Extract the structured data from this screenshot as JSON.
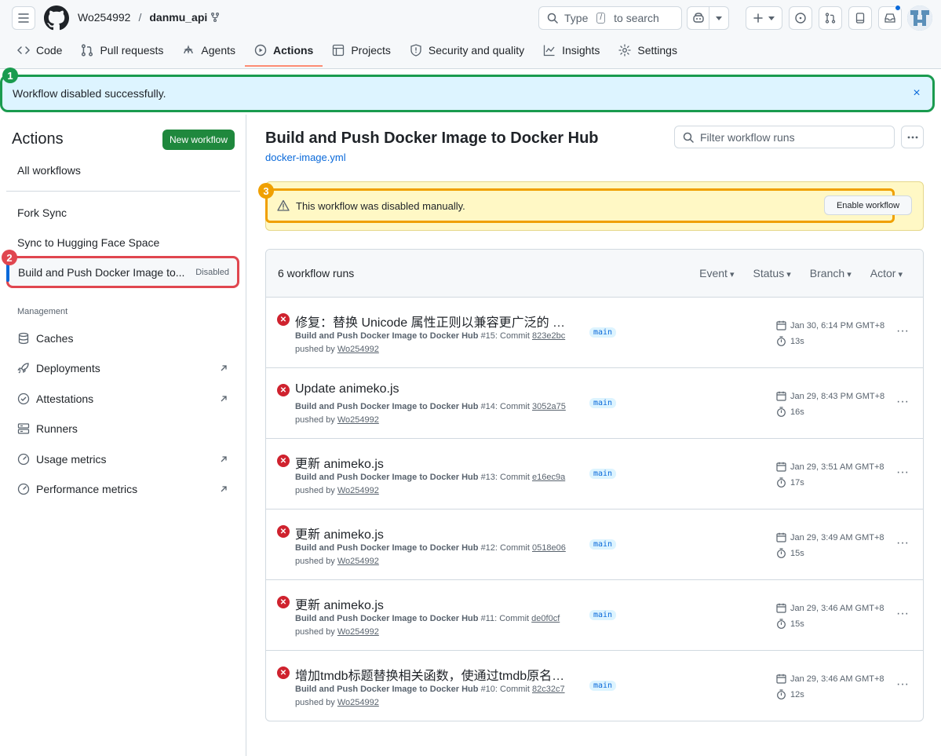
{
  "header": {
    "owner": "Wo254992",
    "separator": "/",
    "repo": "danmu_api",
    "search_prefix": "Type",
    "search_key": "/",
    "search_suffix": "to search"
  },
  "repo_nav": [
    {
      "label": "Code",
      "icon": "code-icon"
    },
    {
      "label": "Pull requests",
      "icon": "pull-request-icon"
    },
    {
      "label": "Agents",
      "icon": "agents-icon"
    },
    {
      "label": "Actions",
      "icon": "play-icon",
      "active": true
    },
    {
      "label": "Projects",
      "icon": "table-icon"
    },
    {
      "label": "Security and quality",
      "icon": "shield-icon"
    },
    {
      "label": "Insights",
      "icon": "graph-icon"
    },
    {
      "label": "Settings",
      "icon": "gear-icon"
    }
  ],
  "flash": {
    "message": "Workflow disabled successfully.",
    "close": "×",
    "marker": "1"
  },
  "sidebar": {
    "title": "Actions",
    "new_workflow": "New workflow",
    "all_workflows": "All workflows",
    "workflows": [
      "Fork Sync",
      "Sync to Hugging Face Space"
    ],
    "selected": {
      "label": "Build and Push Docker Image to...",
      "status": "Disabled",
      "marker": "2"
    },
    "management_title": "Management",
    "management": [
      {
        "label": "Caches",
        "icon": "database-icon",
        "external": false
      },
      {
        "label": "Deployments",
        "icon": "rocket-icon",
        "external": true
      },
      {
        "label": "Attestations",
        "icon": "verified-icon",
        "external": true
      },
      {
        "label": "Runners",
        "icon": "server-icon",
        "external": false
      },
      {
        "label": "Usage metrics",
        "icon": "meter-icon",
        "external": true
      },
      {
        "label": "Performance metrics",
        "icon": "meter-icon",
        "external": true
      }
    ]
  },
  "main": {
    "title": "Build and Push Docker Image to Docker Hub",
    "file": "docker-image.yml",
    "filter_placeholder": "Filter workflow runs",
    "warning": "This workflow was disabled manually.",
    "warning_marker": "3",
    "enable_button": "Enable workflow",
    "runs_count": "6 workflow runs",
    "filters": [
      "Event",
      "Status",
      "Branch",
      "Actor"
    ],
    "runs": [
      {
        "title": "修复：替换 Unicode 属性正则以兼容更广泛的 No...",
        "workflow": "Build and Push Docker Image to Docker Hub",
        "number": "#15: Commit",
        "commit": "823e2bc",
        "pushed_by": "pushed by",
        "user": "Wo254992",
        "branch": "main",
        "date": "Jan 30, 6:14 PM GMT+8",
        "duration": "13s"
      },
      {
        "title": "Update animeko.js",
        "workflow": "Build and Push Docker Image to Docker Hub",
        "number": "#14: Commit",
        "commit": "3052a75",
        "pushed_by": "pushed by",
        "user": "Wo254992",
        "branch": "main",
        "date": "Jan 29, 8:43 PM GMT+8",
        "duration": "16s"
      },
      {
        "title": "更新 animeko.js",
        "workflow": "Build and Push Docker Image to Docker Hub",
        "number": "#13: Commit",
        "commit": "e16ec9a",
        "pushed_by": "pushed by",
        "user": "Wo254992",
        "branch": "main",
        "date": "Jan 29, 3:51 AM GMT+8",
        "duration": "17s"
      },
      {
        "title": "更新 animeko.js",
        "workflow": "Build and Push Docker Image to Docker Hub",
        "number": "#12: Commit",
        "commit": "0518e06",
        "pushed_by": "pushed by",
        "user": "Wo254992",
        "branch": "main",
        "date": "Jan 29, 3:49 AM GMT+8",
        "duration": "15s"
      },
      {
        "title": "更新 animeko.js",
        "workflow": "Build and Push Docker Image to Docker Hub",
        "number": "#11: Commit",
        "commit": "de0f0cf",
        "pushed_by": "pushed by",
        "user": "Wo254992",
        "branch": "main",
        "date": "Jan 29, 3:46 AM GMT+8",
        "duration": "15s"
      },
      {
        "title": "增加tmdb标题替换相关函数，使通过tmdb原名搜...",
        "workflow": "Build and Push Docker Image to Docker Hub",
        "number": "#10: Commit",
        "commit": "82c32c7",
        "pushed_by": "pushed by",
        "user": "Wo254992",
        "branch": "main",
        "date": "Jan 29, 3:46 AM GMT+8",
        "duration": "12s"
      }
    ]
  },
  "colors": {
    "accent": "#0969da",
    "success": "#1f883d",
    "danger": "#cf222e",
    "marker_green": "#1a9b4f",
    "marker_red": "#e0464f",
    "marker_orange": "#f0a000"
  }
}
